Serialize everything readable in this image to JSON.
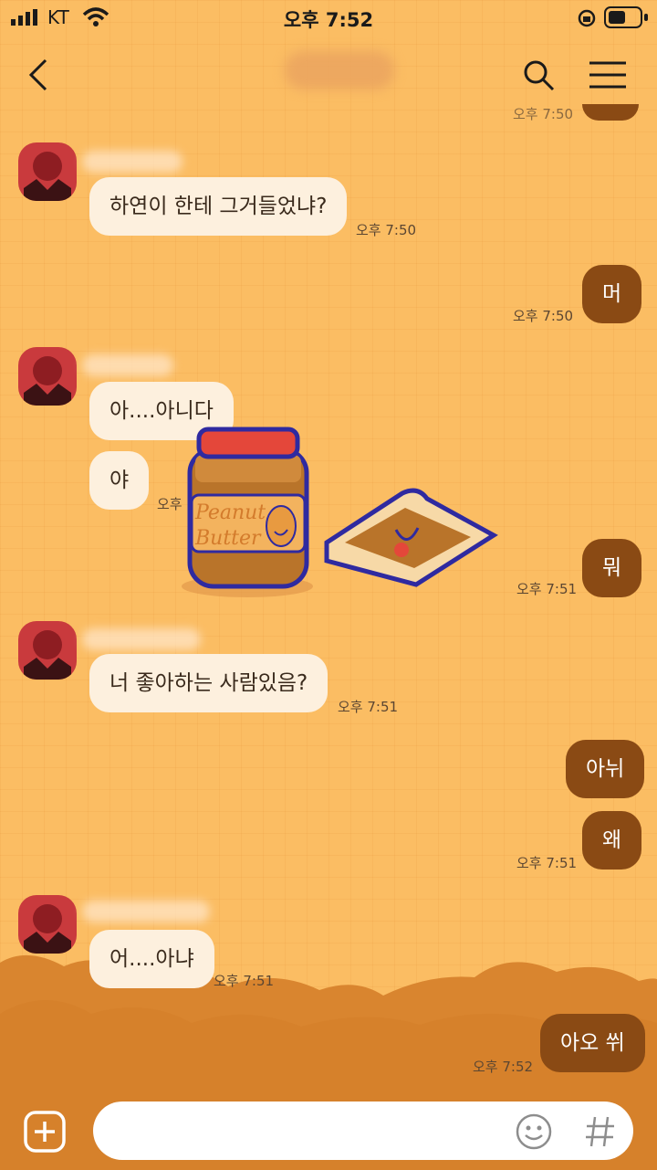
{
  "status_bar": {
    "carrier": "KT",
    "time": "오후 7:52"
  },
  "messages": [
    {
      "dir": "in",
      "text": "하연이 한테 그거들었냐?",
      "time": "오후 7:50"
    },
    {
      "dir": "out",
      "text": "머",
      "time": "오후 7:50"
    },
    {
      "dir": "in",
      "text": "아....아니다"
    },
    {
      "dir": "in",
      "text": "야",
      "time": "오후 7:51"
    },
    {
      "dir": "in",
      "sticker": "peanut-butter-and-toast-sticker"
    },
    {
      "dir": "out",
      "text": "뭐",
      "time": "오후 7:51"
    },
    {
      "dir": "in",
      "text": "너 좋아하는 사람있음?",
      "time": "오후 7:51"
    },
    {
      "dir": "out",
      "text": "아뉘"
    },
    {
      "dir": "out",
      "text": "왜",
      "time": "오후 7:51"
    },
    {
      "dir": "in",
      "text": "어....아냐",
      "time": "오후 7:51"
    },
    {
      "dir": "out",
      "text": "아오 쒸",
      "time": "오후 7:52"
    }
  ],
  "sticker_text": {
    "line1": "Peanut",
    "line2": "Butter"
  },
  "partial_top": {
    "time": "오후 7:50"
  },
  "input": {
    "placeholder": ""
  },
  "icons": [
    "back-arrow-icon",
    "search-icon",
    "menu-icon",
    "plus-icon",
    "emoji-icon",
    "hashtag-icon"
  ],
  "colors": {
    "background": "#fbbd63",
    "bubble_in": "#fdf0de",
    "bubble_out": "#8a4a14",
    "clouds": "#d9852f"
  }
}
